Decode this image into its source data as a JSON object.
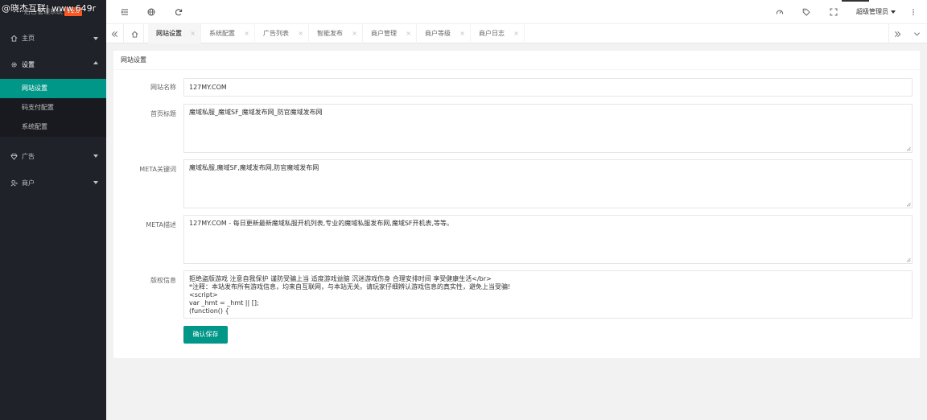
{
  "watermark": "@晓杰互联| www.649r",
  "logo": {
    "text": "后台管理系统",
    "badge": "V1.0"
  },
  "sidebar": {
    "items": [
      {
        "label": "主页",
        "icon": "home-icon"
      },
      {
        "label": "设置",
        "icon": "gear-icon"
      },
      {
        "label": "广告",
        "icon": "diamond-icon"
      },
      {
        "label": "商户",
        "icon": "user-icon"
      }
    ],
    "settings_sub": [
      "网站设置",
      "码支付配置",
      "系统配置"
    ],
    "active_sub": "网站设置"
  },
  "header": {
    "user": "超级管理员"
  },
  "tabs": [
    "网站设置",
    "系统配置",
    "广告列表",
    "智能发布",
    "商户管理",
    "商户等级",
    "商户日志"
  ],
  "tab_close": "×",
  "card": {
    "title": "网站设置"
  },
  "form": {
    "site_name_label": "网站名称",
    "site_name_value": "127MY.COM",
    "home_title_label": "首页标题",
    "home_title_value": "魔域私服_魔域SF_魔域发布网_防官魔域发布网",
    "meta_keywords_label": "META关键词",
    "meta_keywords_value": "魔域私服,魔域SF,魔域发布网,防官魔域发布网",
    "meta_desc_label": "META描述",
    "meta_desc_value": "127MY.COM - 每日更新最新魔域私服开机列表,专业的魔域私服发布网,魔域SF开机表,等等。",
    "copyright_label": "版权信息",
    "copyright_value": "拒绝盗版游戏 注意自我保护 谨防受骗上当 适度游戏益脑 沉迷游戏伤身 合理安排时间 享受健康生活</br>\n*注释：本站发布所有游戏信息，均来自互联网，与本站无关。请玩家仔细辨认游戏信息的真实性，避免上当受骗!\n<script>\nvar _hmt = _hmt || [];\n(function() {",
    "submit_label": "确认保存"
  },
  "colors": {
    "accent": "#009688",
    "sidebar_bg": "#20222a",
    "badge": "#ff5722"
  }
}
